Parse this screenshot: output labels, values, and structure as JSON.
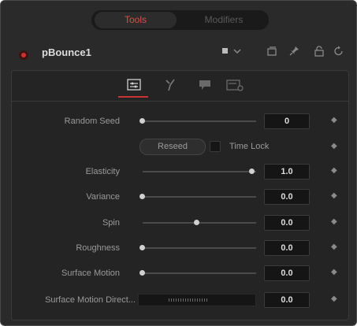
{
  "top_tabs": [
    {
      "label": "Tools",
      "active": true
    },
    {
      "label": "Modifiers",
      "active": false
    }
  ],
  "header": {
    "tool_name": "pBounce1",
    "icons": [
      "square-dropdown-icon",
      "version-icon",
      "pin-icon",
      "lock-icon",
      "reset-icon"
    ]
  },
  "sub_tabs": [
    "controls-icon",
    "style-icon",
    "region-icon",
    "settings-icon"
  ],
  "params": {
    "random_seed": {
      "label": "Random Seed",
      "value": "0",
      "level": 0.0
    },
    "reseed_label": "Reseed",
    "time_lock_label": "Time Lock",
    "elasticity": {
      "label": "Elasticity",
      "value": "1.0",
      "level": 1.0
    },
    "variance": {
      "label": "Variance",
      "value": "0.0",
      "level": 0.0
    },
    "spin": {
      "label": "Spin",
      "value": "0.0",
      "level": 0.5
    },
    "roughness": {
      "label": "Roughness",
      "value": "0.0",
      "level": 0.0
    },
    "surface_motion": {
      "label": "Surface Motion",
      "value": "0.0",
      "level": 0.0
    },
    "surface_motion_direction": {
      "label": "Surface Motion Direct...",
      "value": "0.0"
    }
  },
  "colors": {
    "accent": "#c83434",
    "panel": "#2a2a2a",
    "text": "#9a9a9a"
  }
}
